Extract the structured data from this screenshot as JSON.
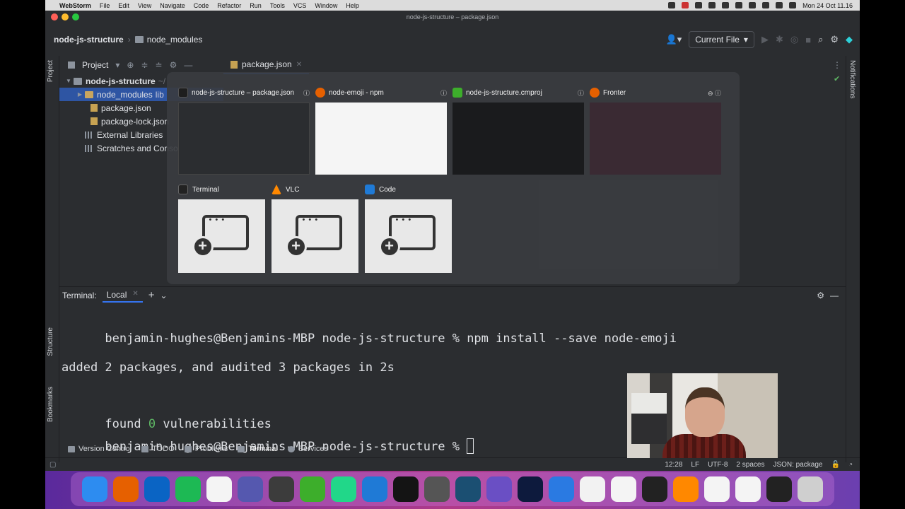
{
  "menubar": {
    "app_name": "WebStorm",
    "items": [
      "File",
      "Edit",
      "View",
      "Navigate",
      "Code",
      "Refactor",
      "Run",
      "Tools",
      "VCS",
      "Window",
      "Help"
    ],
    "clock": "Mon 24 Oct  11.16"
  },
  "window": {
    "title": "node-js-structure – package.json"
  },
  "navbar": {
    "project": "node-js-structure",
    "folder": "node_modules",
    "run_config": "Current File"
  },
  "stripes": {
    "project": "Project",
    "structure": "Structure",
    "bookmarks": "Bookmarks",
    "notifications": "Notifications"
  },
  "project_panel": {
    "title": "Project",
    "tree": [
      {
        "label": "node-js-structure",
        "suffix": "~/",
        "indent": 0,
        "kind": "folder"
      },
      {
        "label": "node_modules",
        "suffix": "lib",
        "indent": 1,
        "kind": "folder"
      },
      {
        "label": "package.json",
        "suffix": "",
        "indent": 2,
        "kind": "file"
      },
      {
        "label": "package-lock.json",
        "suffix": "",
        "indent": 2,
        "kind": "file"
      },
      {
        "label": "External Libraries",
        "suffix": "",
        "indent": 1,
        "kind": "lib"
      },
      {
        "label": "Scratches and Consoles",
        "suffix": "",
        "indent": 1,
        "kind": "lib"
      }
    ]
  },
  "editor": {
    "tab": "package.json"
  },
  "switcher": {
    "windows": [
      {
        "title": "node-js-structure – package.json",
        "icon_color": "#1e1e1e"
      },
      {
        "title": "node-emoji - npm",
        "icon_color": "#e66000"
      },
      {
        "title": "node-js-structure.cmproj",
        "icon_color": "#3dae2b"
      },
      {
        "title": "Fronter",
        "icon_color": "#e66000"
      }
    ],
    "apps": [
      {
        "title": "Terminal",
        "icon_color": "#222222"
      },
      {
        "title": "VLC",
        "icon_color": "#ff8800"
      },
      {
        "title": "Code",
        "icon_color": "#1f7ad6"
      }
    ]
  },
  "terminal": {
    "label": "Terminal:",
    "tab": "Local",
    "prompt": "benjamin-hughes@Benjamins-MBP node-js-structure %",
    "command": "npm install --save node-emoji",
    "output_1": "added 2 packages, and audited 3 packages in 2s",
    "found_prefix": "found ",
    "found_count": "0",
    "found_suffix": " vulnerabilities"
  },
  "bottom_tabs": [
    "Version Control",
    "TODO",
    "Problems",
    "Terminal",
    "Services"
  ],
  "active_bottom_tab": "Terminal",
  "statusbar": {
    "position": "12:28",
    "line_sep": "LF",
    "encoding": "UTF-8",
    "indent": "2 spaces",
    "schema": "JSON: package"
  },
  "dock": {
    "apps": [
      {
        "name": "finder-icon",
        "color": "#2d8cf0"
      },
      {
        "name": "firefox-icon",
        "color": "#e66000"
      },
      {
        "name": "outlook-icon",
        "color": "#0a64c4"
      },
      {
        "name": "spotify-icon",
        "color": "#1db954"
      },
      {
        "name": "typora-icon",
        "color": "#f4f4f4"
      },
      {
        "name": "teams-icon",
        "color": "#5558af"
      },
      {
        "name": "sublime-icon",
        "color": "#3c3c3c"
      },
      {
        "name": "camtasia-icon",
        "color": "#3dae2b"
      },
      {
        "name": "pycharm-icon",
        "color": "#21d789"
      },
      {
        "name": "vscode-icon",
        "color": "#1f7ad6"
      },
      {
        "name": "tracker-icon",
        "color": "#141414"
      },
      {
        "name": "texmaker-icon",
        "color": "#555555"
      },
      {
        "name": "mysql-workbench-icon",
        "color": "#1b4f72"
      },
      {
        "name": "mcu-icon",
        "color": "#6a4fc4"
      },
      {
        "name": "webstorm-icon",
        "color": "#0d1a3d"
      },
      {
        "name": "transmit-icon",
        "color": "#2a7ae2"
      },
      {
        "name": "pages-icon",
        "color": "#f2f2f2"
      },
      {
        "name": "chrome-icon",
        "color": "#f4f4f4"
      },
      {
        "name": "terminal-icon",
        "color": "#222222"
      },
      {
        "name": "vlc-icon",
        "color": "#ff8800"
      },
      {
        "name": "document-icon",
        "color": "#f4f4f4"
      },
      {
        "name": "document2-icon",
        "color": "#f4f4f4"
      },
      {
        "name": "window-icon",
        "color": "#222222"
      },
      {
        "name": "trash-icon",
        "color": "#cfcfcf"
      }
    ]
  }
}
